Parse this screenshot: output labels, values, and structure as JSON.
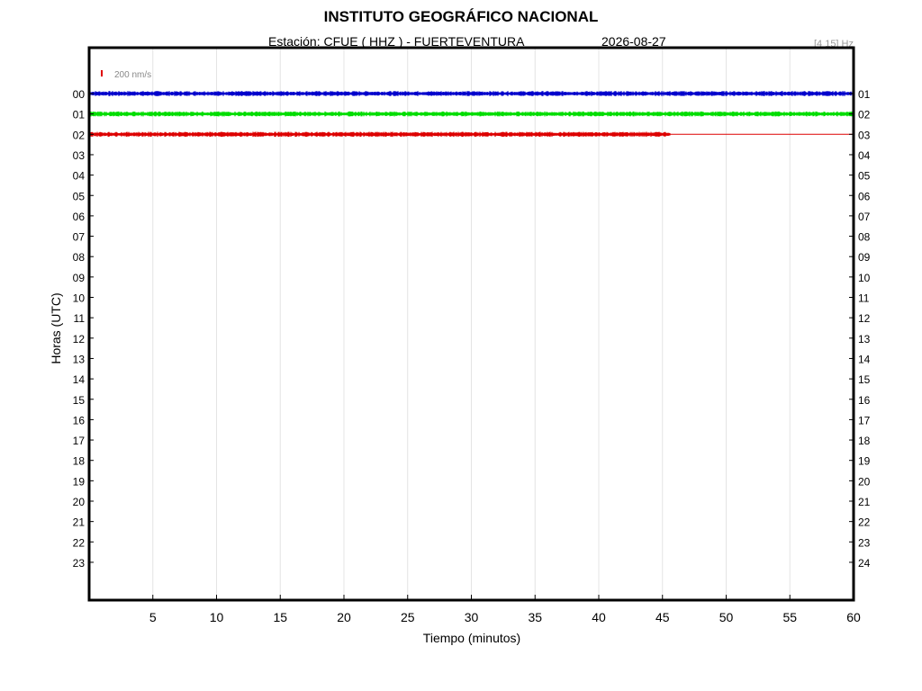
{
  "header": {
    "title": "INSTITUTO GEOGRÁFICO NACIONAL",
    "station": "Estación:  CFUE ( HHZ ) - FUERTEVENTURA",
    "date": "2026-08-27",
    "filter": "[4 15] Hz"
  },
  "chart_data": {
    "type": "line",
    "title": "INSTITUTO GEOGRÁFICO NACIONAL",
    "xlabel": "Tiempo (minutos)",
    "ylabel": "Horas (UTC)",
    "xlim": [
      0,
      60
    ],
    "x_ticks": [
      5,
      10,
      15,
      20,
      25,
      30,
      35,
      40,
      45,
      50,
      55,
      60
    ],
    "y_ticks_left": [
      "00",
      "01",
      "02",
      "03",
      "04",
      "05",
      "06",
      "07",
      "08",
      "09",
      "10",
      "11",
      "12",
      "13",
      "14",
      "15",
      "16",
      "17",
      "18",
      "19",
      "20",
      "21",
      "22",
      "23"
    ],
    "y_ticks_right": [
      "01",
      "02",
      "03",
      "04",
      "05",
      "06",
      "07",
      "08",
      "09",
      "10",
      "11",
      "12",
      "13",
      "14",
      "15",
      "16",
      "17",
      "18",
      "19",
      "20",
      "21",
      "22",
      "23",
      "24"
    ],
    "grid": "vertical",
    "scale_label": "200 nm/s",
    "scale_color": "#e00000",
    "series": [
      {
        "hour": "00",
        "color": "#0000cc",
        "start_min": 0,
        "end_min": 60
      },
      {
        "hour": "01",
        "color": "#00dd00",
        "start_min": 0,
        "end_min": 60
      },
      {
        "hour": "02",
        "color": "#dd0000",
        "start_min": 0,
        "end_min": 45.6,
        "flat_to_min": 60
      }
    ]
  },
  "axes": {
    "xlabel": "Tiempo (minutos)",
    "ylabel": "Horas (UTC)"
  }
}
